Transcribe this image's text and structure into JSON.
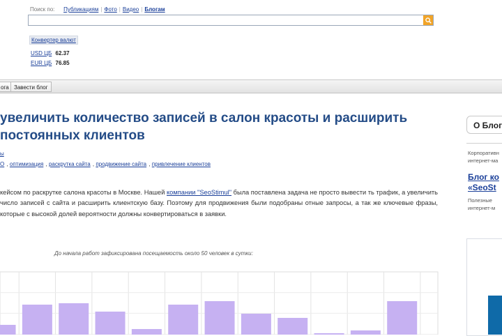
{
  "search": {
    "label": "Поиск по:",
    "tabs": [
      "Публикациям",
      "Фото",
      "Видео",
      "Блогам"
    ],
    "active_tab_index": 3,
    "value": ""
  },
  "currency": {
    "button": "Конвертер валют",
    "rates": [
      {
        "code": "USD ЦБ",
        "value": "62.37"
      },
      {
        "code": "EUR ЦБ",
        "value": "76.85"
      }
    ]
  },
  "nav": {
    "tabs": [
      "ога",
      "Завести блог"
    ]
  },
  "article": {
    "title": "увеличить количество записей в салон красоты и расширить постоянных клиентов",
    "category": "ы",
    "tags": [
      "О",
      "оптимизация",
      "раскрутка сайта",
      "продвижение сайта",
      "привлечение клиентов"
    ],
    "body": {
      "pre": "кейсом по раскрутке салона красоты в Москве. Нашей ",
      "link": "компании \"SeoStimul\"",
      "post": " была поставлена задача не просто вывести ть трафик, а увеличить число записей с сайта и расширить клиентскую базу. Поэтому для продвижения были подобраны отные запросы, а так же ключевые фразы, которые с высокой долей вероятности должны конвертироваться в заявки."
    },
    "caption": "До начала работ зафиксирована посещаемость около 50 человек в сутки:"
  },
  "chart_data": {
    "type": "bar",
    "title": "",
    "xlabel": "",
    "ylabel": "",
    "values": [
      14,
      43,
      45,
      33,
      8,
      43,
      48,
      30,
      24,
      2,
      6,
      48
    ],
    "ylim": [
      0,
      90
    ],
    "grid": true,
    "bar_color": "#c6b1f2"
  },
  "sidebar": {
    "tab": "О Блог",
    "lines1": [
      "Корпоративн",
      "интернет-ма"
    ],
    "title_lines": [
      "Блог ко",
      "«SeoSt"
    ],
    "lines2": [
      "Полезные",
      "интернет-м"
    ]
  },
  "colors": {
    "title": "#244c87",
    "link": "#1a3f99",
    "search_button": "#f1a428"
  }
}
